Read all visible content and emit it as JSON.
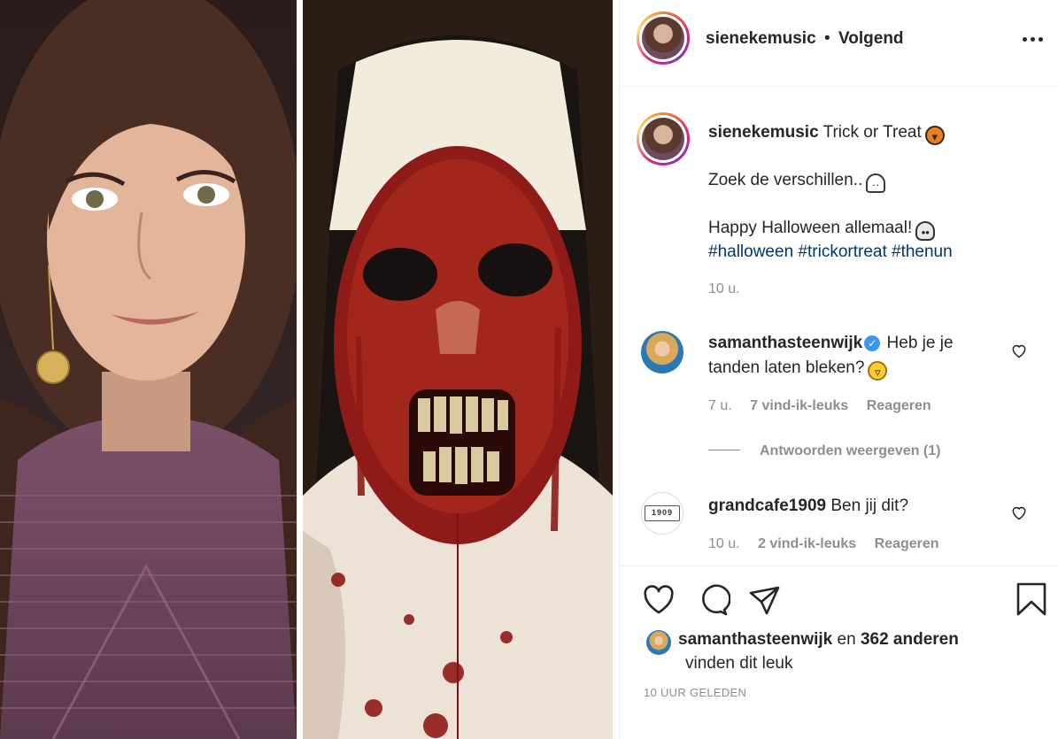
{
  "post": {
    "username": "sienekemusic",
    "dot": "•",
    "follow_status": "Volgend"
  },
  "caption": {
    "username": "sienekemusic",
    "line1": "Trick or Treat",
    "line2": "Zoek de verschillen..",
    "line3": "Happy Halloween allemaal!",
    "hashtags": [
      "#halloween",
      "#trickortreat",
      "#thenun"
    ],
    "time": "10 u."
  },
  "comments": [
    {
      "username": "samanthasteenwijk",
      "verified": true,
      "text": "Heb je je tanden laten bleken?",
      "time": "7 u.",
      "likes": "7 vind-ik-leuks",
      "reply": "Reageren",
      "view_replies": "Antwoorden weergeven (1)"
    },
    {
      "username": "grandcafe1909",
      "verified": false,
      "text": "Ben jij dit?",
      "avatar_text": "1909",
      "time": "10 u.",
      "likes": "2 vind-ik-leuks",
      "reply": "Reageren"
    }
  ],
  "likes": {
    "user": "samanthasteenwijk",
    "and": "en",
    "others": "362 anderen",
    "suffix": "vinden dit leuk"
  },
  "timestamp": "10 UUR GELEDEN",
  "icons": [
    "more-icon",
    "heart-icon",
    "comment-icon",
    "share-icon",
    "bookmark-icon",
    "verified-icon"
  ]
}
